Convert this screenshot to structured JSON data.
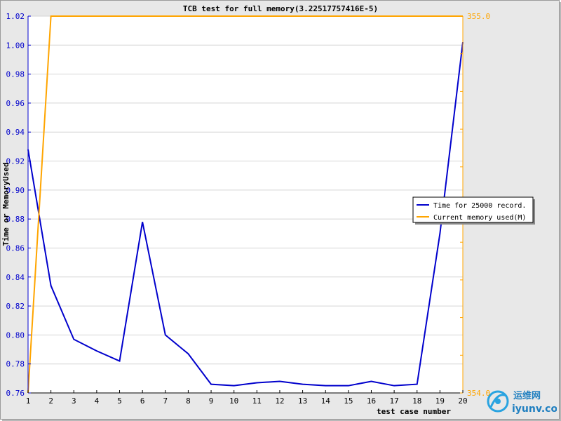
{
  "chart_data": {
    "type": "line",
    "title": "TCB test for full memory(3.22517757416E-5)",
    "xlabel": "test case number",
    "ylabel": "Time or MemoryUsed",
    "x": [
      1,
      2,
      3,
      4,
      5,
      6,
      7,
      8,
      9,
      10,
      11,
      12,
      13,
      14,
      15,
      16,
      17,
      18,
      19,
      20
    ],
    "xlim": [
      1,
      20
    ],
    "ylim": [
      0.76,
      1.02
    ],
    "yticks": [
      0.76,
      0.78,
      0.8,
      0.82,
      0.84,
      0.86,
      0.88,
      0.9,
      0.92,
      0.94,
      0.96,
      0.98,
      1.0,
      1.02
    ],
    "ytick_labels": [
      "0.76",
      "0.78",
      "0.80",
      "0.82",
      "0.84",
      "0.86",
      "0.88",
      "0.90",
      "0.92",
      "0.94",
      "0.96",
      "0.98",
      "1.00",
      "1.02"
    ],
    "y2lim": [
      354.0,
      355.0
    ],
    "y2tick_labels": [
      "354.0",
      "355.0"
    ],
    "grid": true,
    "legend_position": "right",
    "series": [
      {
        "name": "Time for 25000 record.",
        "axis": "left",
        "color": "#0000cc",
        "values": [
          0.928,
          0.834,
          0.797,
          0.789,
          0.782,
          0.878,
          0.8,
          0.787,
          0.766,
          0.765,
          0.767,
          0.768,
          0.766,
          0.765,
          0.765,
          0.768,
          0.765,
          0.766,
          0.87,
          1.002
        ]
      },
      {
        "name": "Current memory used(M)",
        "axis": "right",
        "color": "#ffa500",
        "values": [
          354.0,
          355.0,
          355.0,
          355.0,
          355.0,
          355.0,
          355.0,
          355.0,
          355.0,
          355.0,
          355.0,
          355.0,
          355.0,
          355.0,
          355.0,
          355.0,
          355.0,
          355.0,
          355.0,
          355.0
        ]
      }
    ]
  },
  "watermark": {
    "brand": "运维网",
    "site": "iyunv.com"
  }
}
